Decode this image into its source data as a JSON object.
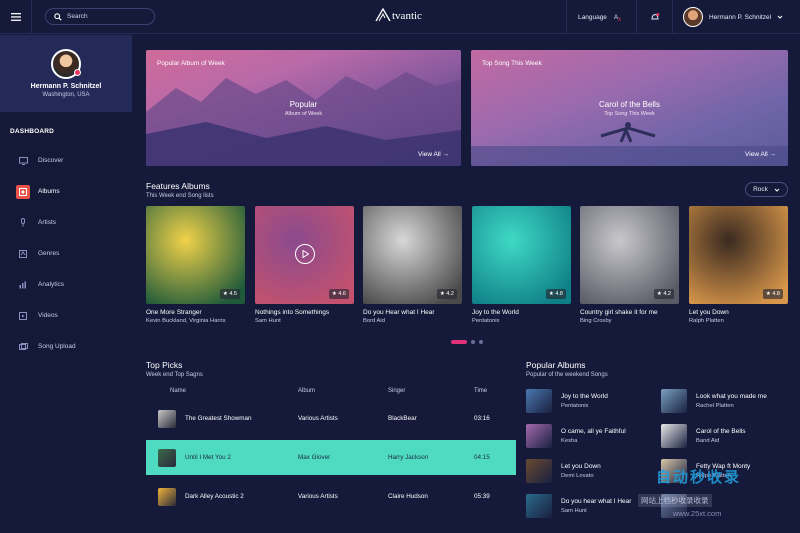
{
  "header": {
    "search_placeholder": "Search",
    "logo_text": "tvantic",
    "language_label": "Language",
    "user_name": "Hermann P. Schnitzel"
  },
  "sidebar": {
    "profile_name": "Hermann P. Schnitzel",
    "profile_location": "Washington, USA",
    "section_label": "DASHBOARD",
    "items": [
      {
        "label": "Discover",
        "icon": "monitor-icon",
        "active": false
      },
      {
        "label": "Albums",
        "icon": "album-icon",
        "active": true
      },
      {
        "label": "Artists",
        "icon": "microphone-icon",
        "active": false
      },
      {
        "label": "Genres",
        "icon": "genre-icon",
        "active": false
      },
      {
        "label": "Analytics",
        "icon": "analytics-icon",
        "active": false
      },
      {
        "label": "Videos",
        "icon": "video-icon",
        "active": false
      },
      {
        "label": "Song Upload",
        "icon": "upload-icon",
        "active": false
      }
    ]
  },
  "banners": [
    {
      "label": "Popular Album of Week",
      "title": "Popular",
      "subtitle": "Album of Week",
      "link": "View All →"
    },
    {
      "label": "Top Song This Week",
      "title": "Carol of the Bells",
      "subtitle": "Top Song This Week",
      "link": "View All →"
    }
  ],
  "features": {
    "title": "Features Albums",
    "subtitle": "This Week end Song lists",
    "filter": "Rock",
    "albums": [
      {
        "title": "One More Stranger",
        "artist": "Kevin Buckland, Virginia Harris",
        "rating": "★ 4.5",
        "color1": "#f1d24a",
        "color2": "#1f5a3a"
      },
      {
        "title": "Nothings into Somethings",
        "artist": "Sam Hunt",
        "rating": "★ 4.6",
        "color1": "#8a4a8e",
        "color2": "#c4526e"
      },
      {
        "title": "Do you Hear what I Hear",
        "artist": "Bord Aid",
        "rating": "★ 4.2",
        "color1": "#d8d8d8",
        "color2": "#4a4a4a"
      },
      {
        "title": "Joy to the World",
        "artist": "Pentatonix",
        "rating": "★ 4.8",
        "color1": "#3fd9c6",
        "color2": "#0e7f86"
      },
      {
        "title": "Country girl shake it for me",
        "artist": "Bing Crosby",
        "rating": "★ 4.2",
        "color1": "#c8c8cc",
        "color2": "#5a5a66"
      },
      {
        "title": "Let you Down",
        "artist": "Ralph Platten",
        "rating": "★ 4.8",
        "color1": "#3a2a20",
        "color2": "#d8964a"
      }
    ]
  },
  "top_picks": {
    "title": "Top Picks",
    "subtitle": "Week end Top Sagns",
    "columns": [
      "Name",
      "Album",
      "Singer",
      "Time"
    ],
    "rows": [
      {
        "name": "The Greatest Showman",
        "album": "Various Artists",
        "singer": "BlackBear",
        "time": "03:16",
        "highlight": false,
        "color": "#c9c9c9"
      },
      {
        "name": "Until I Met You 2",
        "album": "Max Glover",
        "singer": "Harry Jackson",
        "time": "04:15",
        "highlight": true,
        "color": "#3a6a4a"
      },
      {
        "name": "Dark Alley Acoustic 2",
        "album": "Various Artists",
        "singer": "Claire Hudson",
        "time": "05:39",
        "highlight": false,
        "color": "#f0b43a"
      }
    ]
  },
  "popular_albums": {
    "title": "Popular Albums",
    "subtitle": "Popular of the weekend Songs",
    "items": [
      {
        "name": "Joy to the World",
        "artist": "Pentatonix",
        "color": "#4a78b0"
      },
      {
        "name": "Look what you made me",
        "artist": "Rachel Platten",
        "color": "#7aa0c0"
      },
      {
        "name": "O came, all ye Faithful",
        "artist": "Kesha",
        "color": "#a46aae"
      },
      {
        "name": "Carol of the Bells",
        "artist": "Band Aid",
        "color": "#e8e8e8"
      },
      {
        "name": "Let you Down",
        "artist": "Demi Lovato",
        "color": "#6a4a30"
      },
      {
        "name": "Fetty Wap ft Monty",
        "artist": "Ralph Platten",
        "color": "#d8c8a8"
      },
      {
        "name": "Do you hear what I Hear",
        "artist": "Sam Hunt",
        "color": "#2a6a8a"
      },
      {
        "name": "",
        "artist": "",
        "color": "#6a7aa0"
      }
    ]
  },
  "watermark": {
    "title": "自动秒收录",
    "line": "网站上档秒收录收录",
    "url": "www.25xt.com"
  }
}
